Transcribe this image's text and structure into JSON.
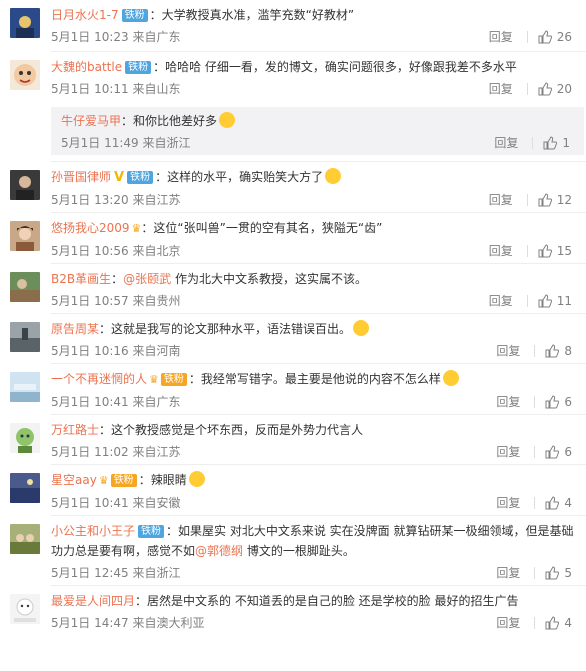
{
  "labels": {
    "reply": "回复",
    "like_icon": "thumb-up-icon"
  },
  "comments": [
    {
      "name": "日月水火1-7",
      "badge": "铁粉",
      "text": "：大学教授真水准，滥竽充数“好教材”",
      "time": "5月1日 10:23 来自广东",
      "likes": "26"
    },
    {
      "name": "大魏的battle",
      "badge": "铁粉",
      "text": "：哈哈哈 仔细一看，发的博文，确实问题很多，好像跟我差不多水平",
      "time": "5月1日 10:11 来自山东",
      "likes": "20",
      "sub": {
        "name": "牛仔爱马甲",
        "text": "：和你比他差好多",
        "time": "5月1日 11:49 来自浙江",
        "likes": "1"
      }
    },
    {
      "name": "孙晋国律师",
      "badge": "铁粉",
      "text": "：这样的水平，确实贻笑大方了",
      "time": "5月1日 13:20 来自江苏",
      "likes": "12"
    },
    {
      "name": "悠扬我心2009",
      "text": "：这位“张叫兽”一贯的空有其名，狭隘无“齿”",
      "time": "5月1日 10:56 来自北京",
      "likes": "15"
    },
    {
      "name": "B2B革画生",
      "mention": "@张颐武",
      "text": " 作为北大中文系教授，这实属不该。",
      "time": "5月1日 10:57 来自贵州",
      "likes": "11"
    },
    {
      "name": "原告周某",
      "text": "：这就是我写的论文那种水平，语法错误百出。",
      "time": "5月1日 10:16 来自河南",
      "likes": "8"
    },
    {
      "name": "一个不再迷惘的人",
      "badge": "铁粉",
      "text": "：我经常写错字。最主要是他说的内容不怎么样",
      "time": "5月1日 10:41 来自广东",
      "likes": "6"
    },
    {
      "name": "万红路士",
      "text": "：这个教授感觉是个坏东西，反而是外势力代言人",
      "time": "5月1日 11:02 来自江苏",
      "likes": "6"
    },
    {
      "name": "星空aay",
      "badge": "铁粉",
      "text": "：辣眼睛",
      "time": "5月1日 10:41 来自安徽",
      "likes": "4"
    },
    {
      "name": "小公主和小王子",
      "badge": "铁粉",
      "text1": "：如果屋实 对北大中文系来说 实在没牌面 就算钻研某一极细领域，但是基础功力总是要有啊，感觉不如",
      "mention": "@郭德纲",
      "text2": " 博文的一根脚趾头。",
      "time": "5月1日 12:45 来自浙江",
      "likes": "5"
    },
    {
      "name": "最爱是人间四月",
      "text": "：居然是中文系的 不知道丢的是自己的脸 还是学校的脸 最好的招生广告",
      "time": "5月1日 14:47 来自澳大利亚",
      "likes": "4"
    }
  ],
  "colors": {
    "name": "#eb7350",
    "meta": "#808080",
    "fan_badge": "#4ea5e0",
    "gold_badge": "#f6a623"
  }
}
